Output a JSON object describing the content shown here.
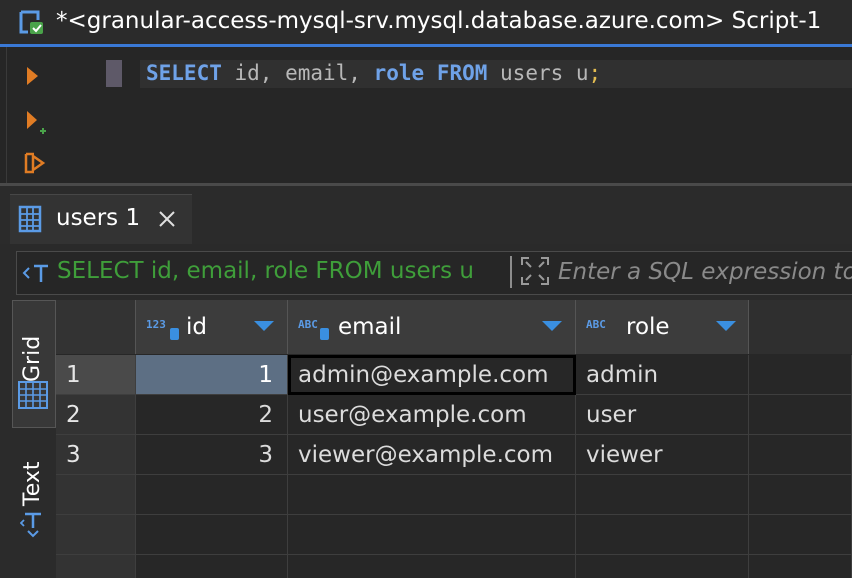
{
  "window": {
    "title": "*<granular-access-mysql-srv.mysql.database.azure.com> Script-1",
    "accent_color": "#3a79d6"
  },
  "editor": {
    "sql_tokens": [
      {
        "text": "SELECT",
        "kind": "keyword"
      },
      {
        "text": " id, email, ",
        "kind": "plain"
      },
      {
        "text": "role",
        "kind": "keyword"
      },
      {
        "text": " ",
        "kind": "plain"
      },
      {
        "text": "FROM",
        "kind": "keyword"
      },
      {
        "text": " users u",
        "kind": "plain"
      },
      {
        "text": ";",
        "kind": "punct"
      }
    ],
    "icons": [
      "run-statement-icon",
      "run-in-new-tab-icon",
      "execute-script-icon"
    ]
  },
  "results": {
    "tab_label": "users 1",
    "filter_query": "SELECT id, email, role FROM users u",
    "filter_placeholder": "Enter a SQL expression to filter results (use Ctrl+Space)",
    "views": {
      "grid_label": "Grid",
      "text_label": "Text"
    },
    "columns": [
      {
        "name": "id",
        "type_badge": "123"
      },
      {
        "name": "email",
        "type_badge": "ABC"
      },
      {
        "name": "role",
        "type_badge": "ABC"
      }
    ],
    "rows": [
      {
        "num": "1",
        "id": "1",
        "email": "admin@example.com",
        "role": "admin"
      },
      {
        "num": "2",
        "id": "2",
        "email": "user@example.com",
        "role": "user"
      },
      {
        "num": "3",
        "id": "3",
        "email": "viewer@example.com",
        "role": "viewer"
      }
    ],
    "colors": {
      "keyword": "#6fa2e8",
      "filter_text": "#3f9e3a",
      "sort_arrow": "#3a8fe0"
    }
  }
}
